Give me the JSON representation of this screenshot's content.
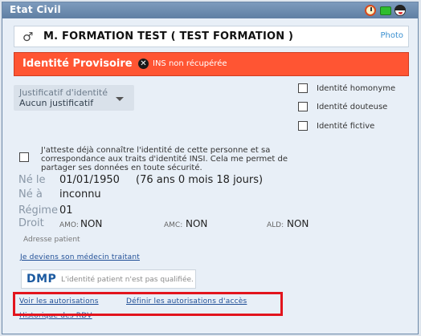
{
  "window": {
    "title": "Etat Civil"
  },
  "patient": {
    "gender_symbol": "♂",
    "name": "M. FORMATION TEST ( TEST FORMATION )",
    "photo_label": "Photo"
  },
  "identity": {
    "status": "Identité Provisoire",
    "ins_status": "INS non récupérée",
    "justificatif_label": "Justificatif d'identité",
    "justificatif_value": "Aucun justificatif"
  },
  "checkboxes": [
    {
      "label": "Identité homonyme",
      "checked": false
    },
    {
      "label": "Identité douteuse",
      "checked": false
    },
    {
      "label": "Identité fictive",
      "checked": false
    }
  ],
  "attestation": "J'atteste déjà connaître l'identité de cette personne et sa correspondance aux traits d'identité INSI. Cela me permet de partager ses données en toute sécurité.",
  "details": {
    "birth_label": "Né le",
    "birth_value": "01/01/1950",
    "age": "(76 ans 0 mois 18 jours)",
    "birthplace_label": "Né à",
    "birthplace_value": "inconnu",
    "regime_label": "Régime",
    "regime_value": "01",
    "droit_label": "Droit",
    "amo_label": "AMO:",
    "amo_value": "NON",
    "amc_label": "AMC:",
    "amc_value": "NON",
    "ald_label": "ALD:",
    "ald_value": "NON",
    "address_label": "Adresse patient"
  },
  "links": {
    "medecin": "Je deviens son médecin traitant",
    "voir": "Voir les autorisations",
    "definir": "Définir les autorisations d'accès",
    "historique": "Historique des RDV"
  },
  "dmp": {
    "logo": "DMP",
    "text": "L'identité patient n'est pas qualifiée."
  },
  "colors": {
    "banner": "#ff5533",
    "titlebar": "#6b88a8",
    "link": "#1f4e96",
    "highlight": "#e2141d"
  }
}
